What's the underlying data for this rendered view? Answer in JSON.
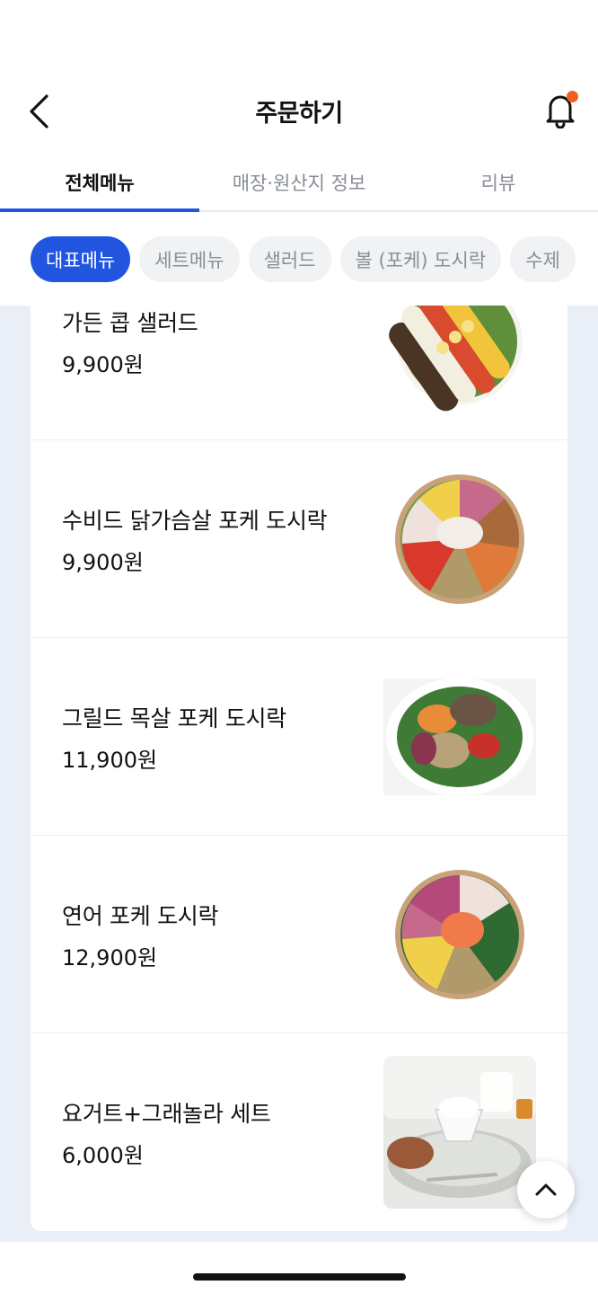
{
  "header": {
    "title": "주문하기",
    "back_icon": "chevron-left-icon",
    "bell_icon": "bell-icon"
  },
  "tabs": [
    {
      "label": "전체메뉴",
      "active": true
    },
    {
      "label": "매장·원산지 정보",
      "active": false
    },
    {
      "label": "리뷰",
      "active": false
    }
  ],
  "chips": [
    {
      "label": "대표메뉴",
      "active": true
    },
    {
      "label": "세트메뉴",
      "active": false
    },
    {
      "label": "샐러드",
      "active": false
    },
    {
      "label": "볼 (포케) 도시락",
      "active": false
    },
    {
      "label": "수제",
      "active": false
    }
  ],
  "menu": [
    {
      "name": "가든 콥 샐러드",
      "price": "9,900원",
      "image": "garden-cobb-salad"
    },
    {
      "name": "수비드 닭가슴살 포케 도시락",
      "price": "9,900원",
      "image": "sous-vide-chicken-poke"
    },
    {
      "name": "그릴드 목살 포케 도시락",
      "price": "11,900원",
      "image": "grilled-pork-poke"
    },
    {
      "name": "연어 포케 도시락",
      "price": "12,900원",
      "image": "salmon-poke"
    },
    {
      "name": "요거트+그래놀라 세트",
      "price": "6,000원",
      "image": "yogurt-granola-set"
    }
  ],
  "colors": {
    "accent": "#2155e0",
    "badge": "#f0601e",
    "list_bg": "#e9eef7"
  },
  "scroll_top_icon": "chevron-up-icon"
}
